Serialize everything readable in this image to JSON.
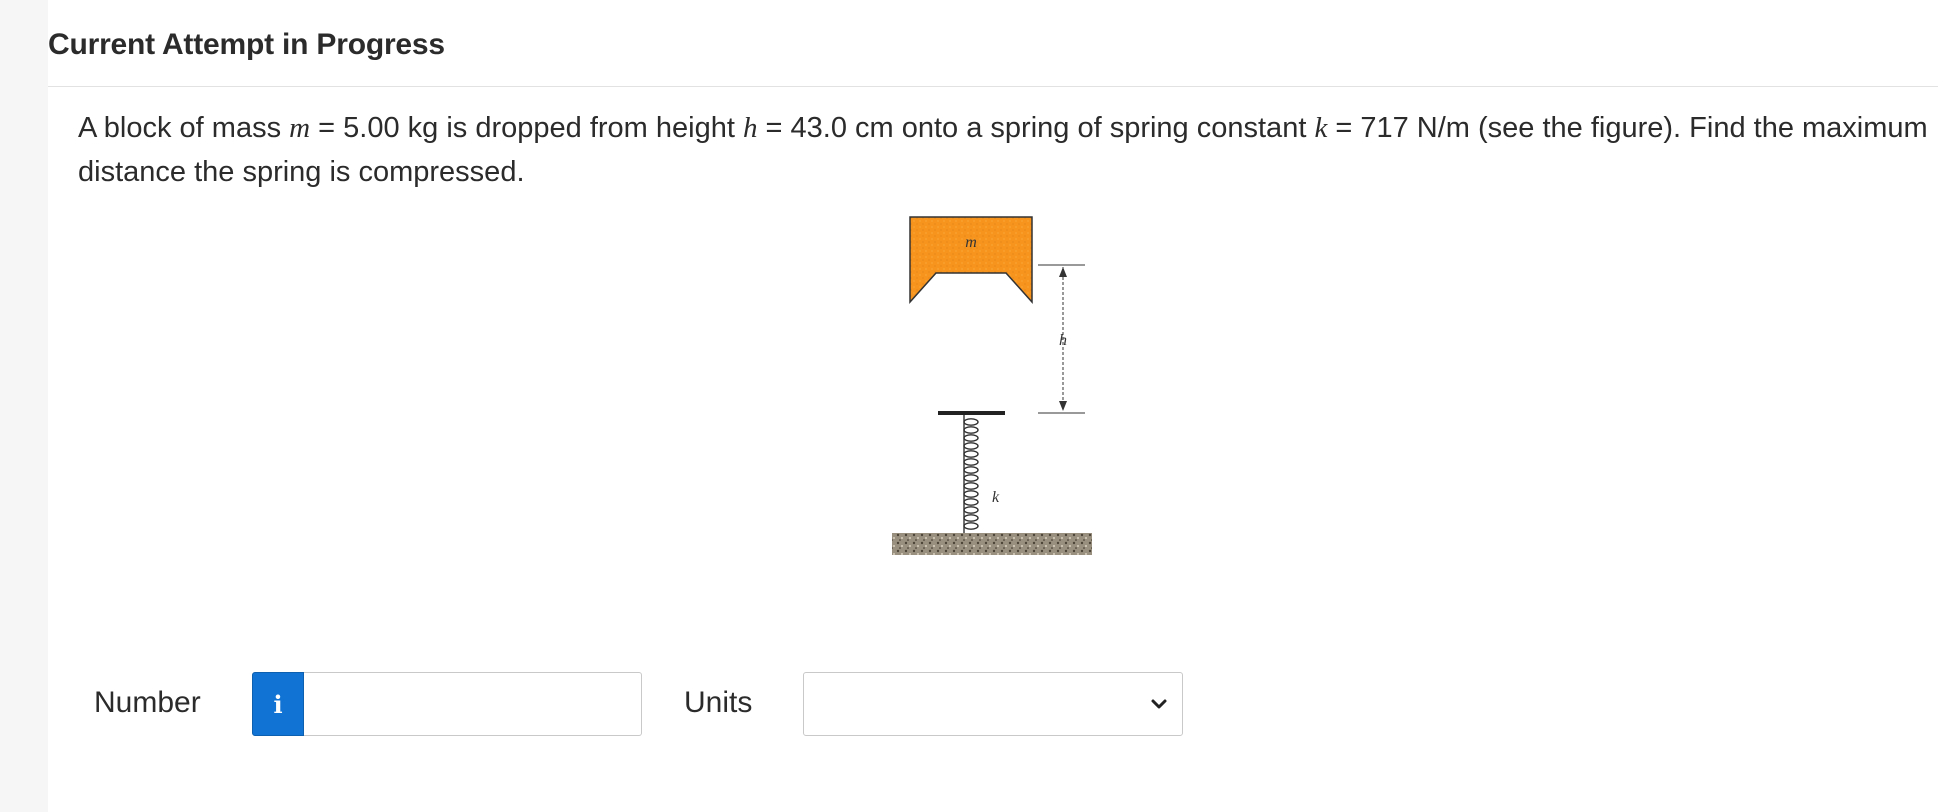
{
  "header": {
    "title": "Current Attempt in Progress"
  },
  "question": {
    "part1": "A block of mass ",
    "m_symbol": "m",
    "part2": " = 5.00 kg is dropped from height ",
    "h_symbol": "h",
    "part3": " = 43.0 cm onto a spring of spring constant ",
    "k_symbol": "k",
    "part4": " = 717 N/m (see the figure). Find the maximum distance the spring is compressed."
  },
  "figure": {
    "block_label": "m",
    "height_label": "h",
    "spring_label": "k",
    "colors": {
      "block": "#f7941d",
      "line": "#222222"
    }
  },
  "answer": {
    "number_label": "Number",
    "info_icon": "i",
    "number_value": "",
    "units_label": "Units",
    "units_selected": ""
  },
  "colors": {
    "accent": "#1173d4"
  }
}
